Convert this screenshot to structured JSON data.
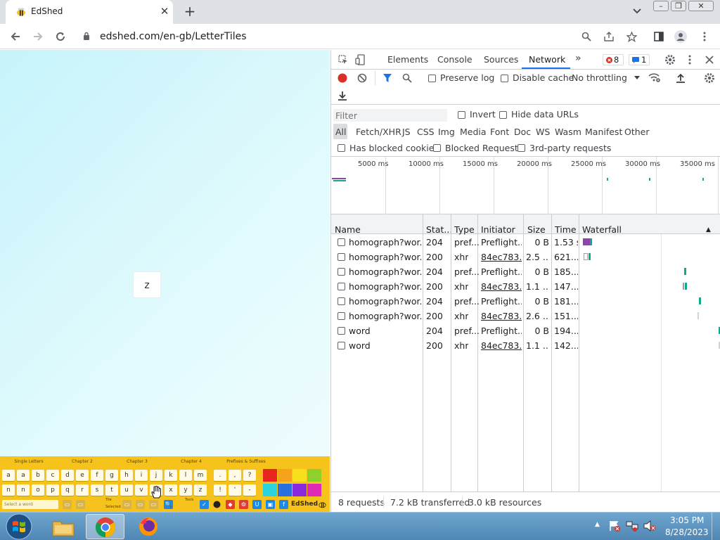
{
  "browser": {
    "tab_title": "EdShed",
    "tab_close": "✕",
    "new_tab": "+",
    "url": "edshed.com/en-gb/LetterTiles",
    "window_controls": [
      "–",
      "❐",
      "✕"
    ]
  },
  "page": {
    "tile_letter": "z",
    "keyboard": {
      "chapters": [
        "Single Letters",
        "Chapter 2",
        "Chapter 3",
        "Chapter 4",
        "Prefixes & Suffixes"
      ],
      "row1_keys": [
        "a",
        "b",
        "c",
        "d",
        "e",
        "f",
        "g",
        "h",
        "i",
        "j",
        "k",
        "l",
        "m"
      ],
      "row2_keys": [
        "n",
        "o",
        "p",
        "q",
        "r",
        "s",
        "t",
        "u",
        "v",
        "w",
        "x",
        "y",
        "z"
      ],
      "punct_row1": [
        ".",
        ",",
        "?"
      ],
      "punct_row2": [
        "!",
        "'",
        "-"
      ],
      "row1_caps": "a",
      "row2_caps": "n",
      "swatches_row1": [
        "#e8261d",
        "#f7a21b",
        "#f7e01b",
        "#8fd12b"
      ],
      "swatches_row2": [
        "#2ad3de",
        "#2a6fde",
        "#8a2ade",
        "#de2ab7"
      ],
      "select_placeholder": "Select a word",
      "tile_label": "Tile",
      "selected_label": "Selected",
      "tools_label": "Tools",
      "brand": "EdShed"
    }
  },
  "devtools": {
    "tabs": [
      "Elements",
      "Console",
      "Sources",
      "Network"
    ],
    "active_tab": "Network",
    "more_tabs": "»",
    "errors_count": "8",
    "messages_count": "1",
    "preserve_log": "Preserve log",
    "disable_cache": "Disable cache",
    "throttling": "No throttling",
    "filter_placeholder": "Filter",
    "invert": "Invert",
    "hide_data_urls": "Hide data URLs",
    "filter_types": [
      "All",
      "Fetch/XHR",
      "JS",
      "CSS",
      "Img",
      "Media",
      "Font",
      "Doc",
      "WS",
      "Wasm",
      "Manifest",
      "Other"
    ],
    "blocked_cookies": "Has blocked cookies",
    "blocked_requests": "Blocked Requests",
    "third_party": "3rd-party requests",
    "timeline_ticks": [
      "5000 ms",
      "10000 ms",
      "15000 ms",
      "20000 ms",
      "25000 ms",
      "30000 ms",
      "35000 ms"
    ],
    "columns": [
      "Name",
      "Stat...",
      "Type",
      "Initiator",
      "Size",
      "Time",
      "Waterfall"
    ],
    "sort_indicator": "▲",
    "requests": [
      {
        "name": "homograph?wor...",
        "status": "204",
        "type": "pref...",
        "initiator": "Preflight...",
        "size": "0 B",
        "time": "1.53 s",
        "initiator_link": false
      },
      {
        "name": "homograph?wor...",
        "status": "200",
        "type": "xhr",
        "initiator": "84ec783....",
        "size": "2.5 ...",
        "time": "621...",
        "initiator_link": true
      },
      {
        "name": "homograph?wor...",
        "status": "204",
        "type": "pref...",
        "initiator": "Preflight...",
        "size": "0 B",
        "time": "185...",
        "initiator_link": false
      },
      {
        "name": "homograph?wor...",
        "status": "200",
        "type": "xhr",
        "initiator": "84ec783....",
        "size": "1.1 ...",
        "time": "147...",
        "initiator_link": true
      },
      {
        "name": "homograph?wor...",
        "status": "204",
        "type": "pref...",
        "initiator": "Preflight...",
        "size": "0 B",
        "time": "181...",
        "initiator_link": false
      },
      {
        "name": "homograph?wor...",
        "status": "200",
        "type": "xhr",
        "initiator": "84ec783....",
        "size": "2.6 ...",
        "time": "151...",
        "initiator_link": true
      },
      {
        "name": "word",
        "status": "204",
        "type": "pref...",
        "initiator": "Preflight...",
        "size": "0 B",
        "time": "194...",
        "initiator_link": false
      },
      {
        "name": "word",
        "status": "200",
        "type": "xhr",
        "initiator": "84ec783....",
        "size": "1.1 ...",
        "time": "142...",
        "initiator_link": true
      }
    ],
    "status_bar": {
      "requests": "8 requests",
      "transferred": "7.2 kB transferred",
      "resources": "3.0 kB resources"
    }
  },
  "taskbar": {
    "time": "3:05 PM",
    "date": "8/28/2023"
  },
  "colors": {
    "record_red": "#d93025",
    "accent_blue": "#1a73e8",
    "preflight_purple": "#8e44ad",
    "xhr_green": "#12a88a"
  }
}
